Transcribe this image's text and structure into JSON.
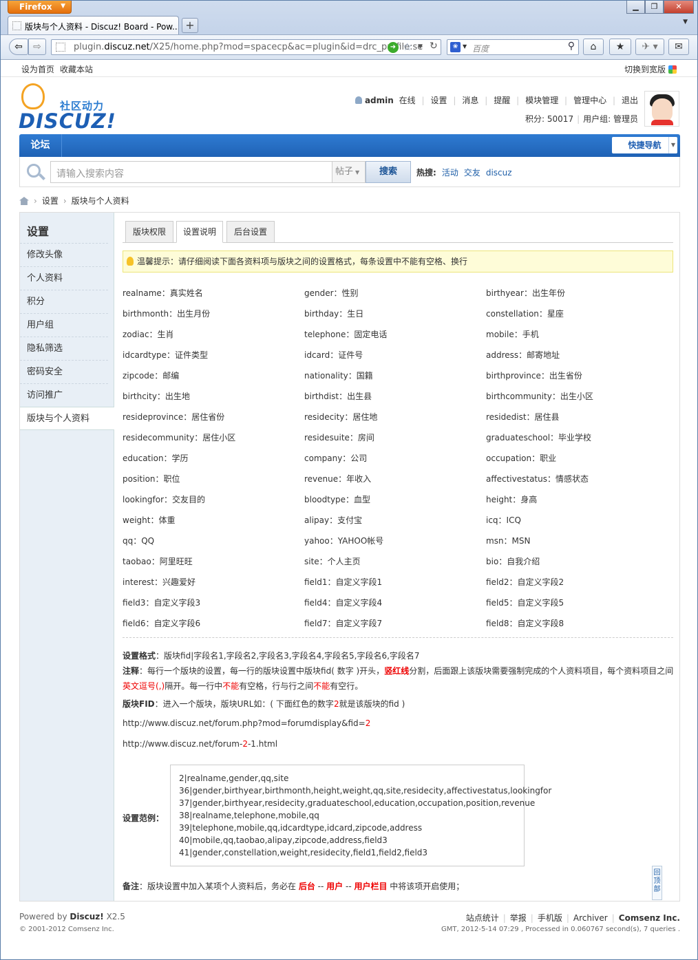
{
  "browser": {
    "app_button": "Firefox",
    "tab_title": "版块与个人资料 - Discuz! Board - Pow...",
    "new_tab": "+",
    "url_prefix": "plugin.",
    "url_domain": "discuz.net",
    "url_rest": "/X25/home.php?mod=spacecp&ac=plugin&id=drc_profile:se",
    "search_placeholder": "百度"
  },
  "topbar": {
    "left": [
      "设为首页",
      "收藏本站"
    ],
    "right": "切换到宽版"
  },
  "logo": {
    "cn": "社区动力",
    "en": "DISCUZ!"
  },
  "usermenu": {
    "username": "admin",
    "status": "在线",
    "links": [
      "设置",
      "消息",
      "提醒",
      "模块管理",
      "管理中心",
      "退出"
    ],
    "points_label": "积分: 50017",
    "group_label": "用户组: 管理员"
  },
  "nav": {
    "tab": "论坛",
    "quick_nav": "快捷导航"
  },
  "search": {
    "placeholder": "请输入搜索内容",
    "type": "帖子",
    "button": "搜索",
    "hot_label": "热搜:",
    "hot": [
      "活动",
      "交友",
      "discuz"
    ]
  },
  "breadcrumb": [
    "设置",
    "版块与个人资料"
  ],
  "sidebar": {
    "title": "设置",
    "items": [
      "修改头像",
      "个人资料",
      "积分",
      "用户组",
      "隐私筛选",
      "密码安全",
      "访问推广",
      "版块与个人资料"
    ]
  },
  "tabs": [
    "版块权限",
    "设置说明",
    "后台设置"
  ],
  "tip": "温馨提示：请仔细阅读下面各资料项与版块之间的设置格式，每条设置中不能有空格、换行",
  "fields": [
    [
      "realname：真实姓名",
      "gender：性别",
      "birthyear：出生年份"
    ],
    [
      "birthmonth：出生月份",
      "birthday：生日",
      "constellation：星座"
    ],
    [
      "zodiac：生肖",
      "telephone：固定电话",
      "mobile：手机"
    ],
    [
      "idcardtype：证件类型",
      "idcard：证件号",
      "address：邮寄地址"
    ],
    [
      "zipcode：邮编",
      "nationality：国籍",
      "birthprovince：出生省份"
    ],
    [
      "birthcity：出生地",
      "birthdist：出生县",
      "birthcommunity：出生小区"
    ],
    [
      "resideprovince：居住省份",
      "residecity：居住地",
      "residedist：居住县"
    ],
    [
      "residecommunity：居住小区",
      "residesuite：房间",
      "graduateschool：毕业学校"
    ],
    [
      "education：学历",
      "company：公司",
      "occupation：职业"
    ],
    [
      "position：职位",
      "revenue：年收入",
      "affectivestatus：情感状态"
    ],
    [
      "lookingfor：交友目的",
      "bloodtype：血型",
      "height：身高"
    ],
    [
      "weight：体重",
      "alipay：支付宝",
      "icq：ICQ"
    ],
    [
      "qq：QQ",
      "yahoo：YAHOO帐号",
      "msn：MSN"
    ],
    [
      "taobao：阿里旺旺",
      "site：个人主页",
      "bio：自我介绍"
    ],
    [
      "interest：兴趣爱好",
      "field1：自定义字段1",
      "field2：自定义字段2"
    ],
    [
      "field3：自定义字段3",
      "field4：自定义字段4",
      "field5：自定义字段5"
    ],
    [
      "field6：自定义字段6",
      "field7：自定义字段7",
      "field8：自定义字段8"
    ]
  ],
  "notes": {
    "format_label": "设置格式",
    "format_text": "：版块fid|字段名1,字段名2,字段名3,字段名4,字段名5,字段名6,字段名7",
    "note_label": "注释",
    "note_a": "：每行一个版块的设置，每一行的版块设置中版块fid( 数字 )开头，",
    "note_red1": "竖红线",
    "note_b": "分割，后面跟上该版块需要强制完成的个人资料项目，每个资料项目之间",
    "note_red2": "英文逗号(,)",
    "note_c": "隔开。每一行中",
    "note_red3": "不能",
    "note_d": "有空格，行与行之间",
    "note_red4": "不能",
    "note_e": "有空行。",
    "fid_label": "版块FID",
    "fid_a": "：进入一个版块，版块URL如：( 下面红色的数字",
    "fid_red": "2",
    "fid_b": "就是该版块的fid )",
    "url1_a": "http://www.discuz.net/forum.php?mod=forumdisplay&fid=",
    "url1_red": "2",
    "url2_a": "http://www.discuz.net/forum-",
    "url2_red": "2",
    "url2_b": "-1.html"
  },
  "example": {
    "label": "设置范例：",
    "lines": [
      "2|realname,gender,qq,site",
      "36|gender,birthyear,birthmonth,height,weight,qq,site,residecity,affectivestatus,lookingfor",
      "37|gender,birthyear,residecity,graduateschool,education,occupation,position,revenue",
      "38|realname,telephone,mobile,qq",
      "39|telephone,mobile,qq,idcardtype,idcard,zipcode,address",
      "40|mobile,qq,taobao,alipay,zipcode,address,field3",
      "41|gender,constellation,weight,residecity,field1,field2,field3"
    ]
  },
  "remark": {
    "label": "备注",
    "a": "：版块设置中加入某项个人资料后，务必在 ",
    "r1": "后台",
    "s1": " -- ",
    "r2": "用户",
    "s2": " -- ",
    "r3": "用户栏目",
    "b": " 中将该项开启使用；"
  },
  "totop": "回顶部",
  "footer": {
    "powered": "Powered by",
    "brand": "Discuz!",
    "version": "X2.5",
    "copyright": "© 2001-2012 Comsenz Inc.",
    "links": [
      "站点统计",
      "举报",
      "手机版",
      "Archiver"
    ],
    "company": "Comsenz Inc.",
    "stats": "GMT, 2012-5-14 07:29 , Processed in 0.060767 second(s), 7 queries ."
  }
}
